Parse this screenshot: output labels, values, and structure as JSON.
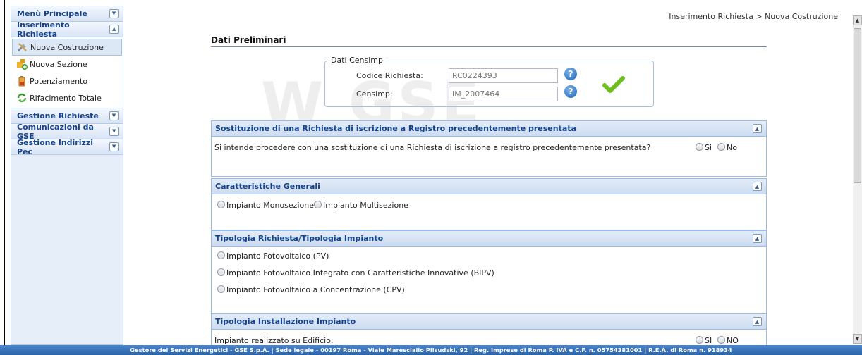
{
  "breadcrumb": "Inserimento Richiesta > Nuova Costruzione",
  "sidebar": {
    "sections": [
      {
        "label": "Menù Principale",
        "state": "collapsed"
      },
      {
        "label": "Inserimento Richiesta",
        "state": "expanded",
        "items": [
          {
            "label": "Nuova Costruzione",
            "icon": "tools-icon",
            "selected": true
          },
          {
            "label": "Nuova Sezione",
            "icon": "puzzle-add-icon"
          },
          {
            "label": "Potenziamento",
            "icon": "battery-icon"
          },
          {
            "label": "Rifacimento Totale",
            "icon": "refresh-icon"
          }
        ]
      },
      {
        "label": "Gestione Richieste",
        "state": "collapsed"
      },
      {
        "label": "Comunicazioni da GSE",
        "state": "collapsed"
      },
      {
        "label": "Gestione Indirizzi Pec",
        "state": "collapsed"
      }
    ]
  },
  "main": {
    "title": "Dati Preliminari",
    "censimp": {
      "legend": "Dati Censimp",
      "codice_label": "Codice Richiesta:",
      "codice_value": "RC0224393",
      "censimp_label": "Censimp:",
      "censimp_value": "IM_2007464"
    },
    "panels": [
      {
        "title": "Sostituzione di una Richiesta di iscrizione a Registro precedentemente presentata",
        "question": "Si intende procedere con una sostituzione di una Richiesta di iscrizione a registro precedentemente presentata?",
        "options": [
          "Si",
          "No"
        ]
      },
      {
        "title": "Caratteristiche Generali",
        "options": [
          "Impianto Monosezione",
          "Impianto Multisezione"
        ]
      },
      {
        "title": "Tipologia Richiesta/Tipologia Impianto",
        "options": [
          "Impianto Fotovoltaico (PV)",
          "Impianto Fotovoltaico Integrato con Caratteristiche Innovative (BIPV)",
          "Impianto Fotovoltaico a Concentrazione (CPV)"
        ]
      },
      {
        "title": "Tipologia Installazione Impianto",
        "question": "Impianto realizzato su Edificio:",
        "options": [
          "SI",
          "NO"
        ]
      }
    ]
  },
  "footer": "Gestore dei Servizi Energetici - GSE S.p.A. | Sede legale - 00197 Roma - Viale Maresciallo Pilsudski, 92 | Reg. Imprese di Roma P. IVA e C.F. n. 05754381001 | R.E.A. di Roma n. 918934",
  "colors": {
    "accent": "#15428b",
    "panel_header": "#cddcf1",
    "footer": "#2b64a9",
    "check": "#6cbf1a"
  }
}
